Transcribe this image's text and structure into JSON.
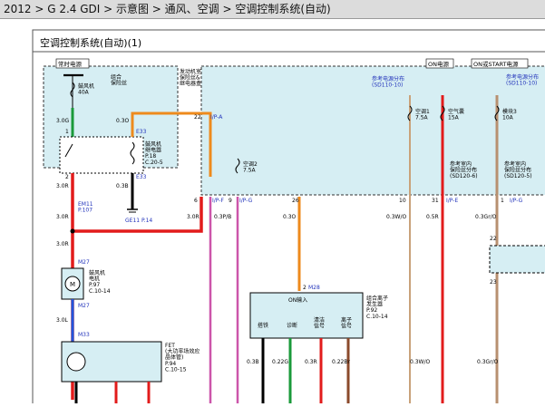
{
  "breadcrumb": {
    "text": "2012 > G 2.4 GDI > 示意图 > 通风、空调 > 空调控制系统(自动)"
  },
  "diagram": {
    "title": "空调控制系统(自动)(1)",
    "labels": {
      "always_power": "常时电源",
      "fuse_combo": "组合\n保险丝",
      "fuse_fan": "鼓风机\n40A",
      "engine_fuse_box": "发动机室\n保险丝&\n继电器盒",
      "on_power": "ON电源",
      "on_start_power": "ON或START电源",
      "power_dist_ref1": "参考电源分布\n(SD110-10)",
      "power_dist_ref2": "参考电源分布\n(SD110-10)",
      "fan_relay": "鼓风机\n继电器\nP.18\nC.20-5",
      "ac1_fuse": "空调1\n7.5A",
      "air_bag_fuse": "空气囊\n15A",
      "module3_fuse": "模块3\n10A",
      "ac2_fuse": "空调2\n7.5A",
      "indoor_dist1": "参考室内\n保险丝分布\n(SD120-6)",
      "indoor_dist2": "参考室内\n保险丝分布\n(SD120-5)",
      "em11": "EM11\nP.107",
      "ge11": "GE11 P.14",
      "m27": "M27",
      "blower_motor": "鼓风机\n电机\nP.97\nC.10-14",
      "m33": "M33",
      "fet": "FET\n(大功率场效应\n晶体管)\nP.94\nC.10-15",
      "m28": "M28",
      "on_input": "ON输入",
      "ion_gen": "组合离子\n发生器\nP.92\nC.10-14",
      "pin_ground": "搭铁",
      "pin_diag": "诊断",
      "pin_clean": "清洁\n信号",
      "pin_ion": "离子\n信号",
      "m28b": "M28",
      "ipa": "I/P-A",
      "ipf": "I/P-F",
      "ipg": "I/P-G",
      "ipe": "I/P-E",
      "ipg2": "I/P-G",
      "e33": "E33",
      "e33b": "E33"
    },
    "wires": {
      "w30g": "3.0G",
      "w03o_top": "0.3O",
      "w30r_top": "3.0R",
      "w03b": "0.3B",
      "w30r_mid": "3.0R",
      "w30r_low": "3.0R",
      "w30r_left": "3.0R",
      "w03pb": "0.3P/B",
      "w03o": "0.3O",
      "w03wo": "0.3W/O",
      "w05r": "0.5R",
      "w03gro": "0.3Gr/O",
      "w30r_motor": "3.0R",
      "w30l": "3.0L",
      "w03b_ion": "0.3B",
      "w022g": "0.22G",
      "w03r_ion": "0.3R",
      "w022br": "0.22Br",
      "w03gro_low": "0.3Gr/O"
    },
    "pins": {
      "p1": "1",
      "p2": "2",
      "p3": "3",
      "p4": "4",
      "p5": "5",
      "p6": "6",
      "p9": "9",
      "p10": "10",
      "p22": "22",
      "p22b": "22",
      "p23": "23",
      "p26": "26",
      "p31": "31",
      "p1b": "1",
      "p2b": "2",
      "p3b": "3",
      "p1c": "1",
      "p2c": "2",
      "p4c": "4",
      "p3c": "3",
      "p1d": "1",
      "p2d": "2",
      "p3d": "3",
      "p4d": "4",
      "p5d": "5"
    }
  }
}
